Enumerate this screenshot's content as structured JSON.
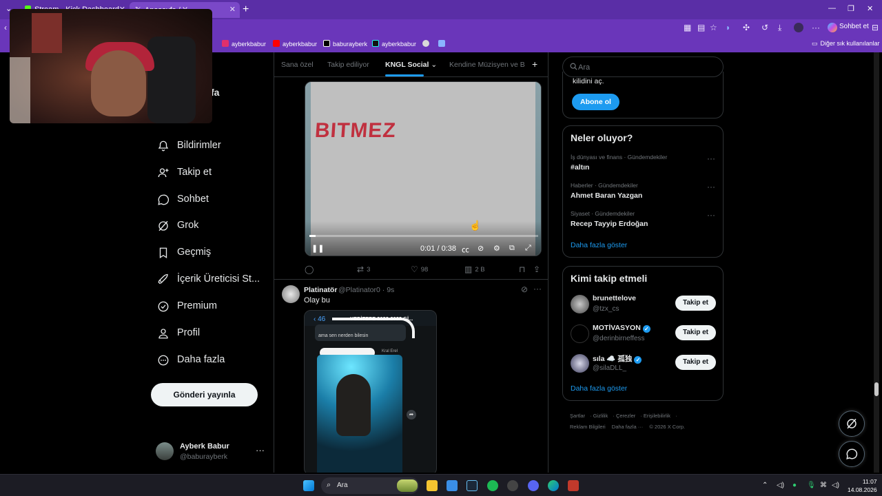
{
  "browser": {
    "tabs": [
      {
        "label": "Stream - Kick Dashboard",
        "active": false
      },
      {
        "label": "Anasayfa / X",
        "active": true
      }
    ],
    "sohbet_label": "Sohbet et",
    "bookmarks": [
      {
        "label": "ayberkbabur",
        "icon": "instagram-icon",
        "color": "#e1306c"
      },
      {
        "label": "ayberkbabur",
        "icon": "youtube-icon",
        "color": "#ff0000"
      },
      {
        "label": "baburayberk",
        "icon": "x-icon",
        "color": "#ffffff"
      },
      {
        "label": "ayberkbabur",
        "icon": "tiktok-icon",
        "color": "#111111"
      }
    ],
    "other_bookmarks_label": "Diğer sık kullanılanlar"
  },
  "nav": {
    "partial_title": "fa",
    "items": [
      {
        "label": "Bildirimler",
        "icon": "bell-icon"
      },
      {
        "label": "Takip et",
        "icon": "person-plus-icon"
      },
      {
        "label": "Sohbet",
        "icon": "chat-bubble-icon"
      },
      {
        "label": "Grok",
        "icon": "grok-icon"
      },
      {
        "label": "Geçmiş",
        "icon": "bookmark-icon"
      },
      {
        "label": "İçerik Üreticisi St...",
        "icon": "rocket-icon"
      },
      {
        "label": "Premium",
        "icon": "verified-badge-icon"
      },
      {
        "label": "Profil",
        "icon": "person-icon"
      },
      {
        "label": "Daha fazla",
        "icon": "more-circle-icon"
      }
    ],
    "post_button": "Gönderi yayınla",
    "account": {
      "name": "Ayberk Babur",
      "handle": "@baburayberk"
    }
  },
  "feed": {
    "tabs": [
      "Sana özel",
      "Takip ediliyor",
      "KNGL Social",
      "Kendine Müzisyen ve Ba"
    ],
    "active_tab": "KNGL Social",
    "video": {
      "overlay_text": "BITMEZ",
      "time": "0:01 / 0:38",
      "progress": 0.026
    },
    "tweet1_actions": {
      "replies": "",
      "reposts": "3",
      "likes": "98",
      "views": "2 B"
    },
    "tweet2": {
      "name": "Platinatör",
      "handle": "@Platinator0 · 9s",
      "text": "Olay bu",
      "media": {
        "back_count": "46",
        "chat_title": "YEDİTEPE 2022-2023 Gİ...",
        "bubble_text": "ama sen nerden bilesin",
        "sender": "Kral Erel"
      }
    }
  },
  "right": {
    "search_placeholder": "Ara",
    "premium": {
      "text": "kilidini aç.",
      "button": "Abone ol"
    },
    "trends": {
      "title": "Neler oluyor?",
      "items": [
        {
          "context": "İş dünyası ve finans · Gündemdekiler",
          "title": "#altın"
        },
        {
          "context": "Haberler · Gündemdekiler",
          "title": "Ahmet Baran Yazgan"
        },
        {
          "context": "Siyaset · Gündemdekiler",
          "title": "Recep Tayyip Erdoğan"
        }
      ],
      "show_more": "Daha fazla göster"
    },
    "who_to_follow": {
      "title": "Kimi takip etmeli",
      "items": [
        {
          "name": "brunettelove",
          "handle": "@tzx_cs",
          "verified": false,
          "button": "Takip et"
        },
        {
          "name": "MOTİVASYON",
          "handle": "@derinbirneffess",
          "verified": true,
          "button": "Takip et"
        },
        {
          "name": "sıla ☁️ 孤独",
          "handle": "@silaDLL_",
          "verified": true,
          "button": "Takip et"
        }
      ],
      "show_more": "Daha fazla göster"
    },
    "footer": {
      "links": [
        "Şartlar",
        "Gizlilik",
        "Çerezler",
        "Erişilebilirlik",
        "Reklam Bilgileri",
        "Daha fazla ···"
      ],
      "copyright": "© 2026 X Corp."
    }
  },
  "taskbar": {
    "search_label": "Ara",
    "time": "11:07",
    "date": "14.08.2026"
  }
}
